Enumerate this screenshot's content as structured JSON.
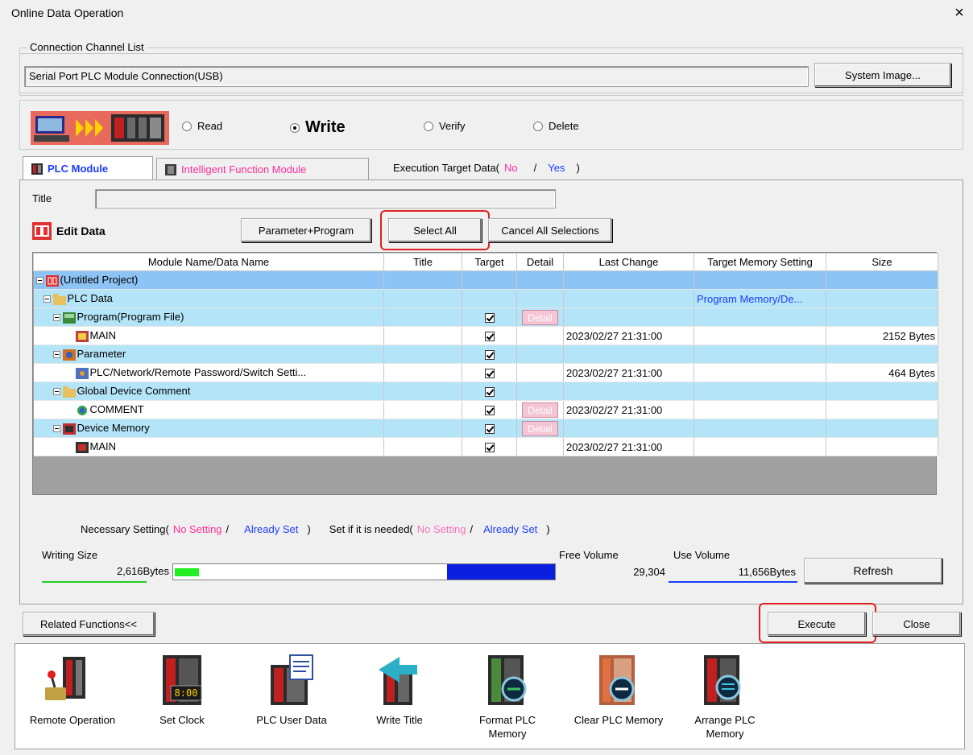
{
  "window": {
    "title": "Online Data Operation",
    "close_glyph": "×"
  },
  "connection": {
    "group_label": "Connection Channel List",
    "value": "Serial Port  PLC Module Connection(USB)",
    "system_image_button": "System Image..."
  },
  "operation": {
    "read": "Read",
    "write": "Write",
    "verify": "Verify",
    "delete": "Delete",
    "selected": "write"
  },
  "tabs": {
    "plc_module": "PLC Module",
    "intelligent": "Intelligent Function Module",
    "exec_target": "Execution Target Data(",
    "no": "No",
    "slash": "/",
    "yes": "Yes",
    "close_paren": ")"
  },
  "title_label": "Title",
  "title_value": "",
  "edit_data_label": "Edit Data",
  "buttons": {
    "param_program": "Parameter+Program",
    "select_all": "Select All",
    "cancel_all": "Cancel All Selections",
    "refresh": "Refresh",
    "related": "Related Functions<<",
    "execute": "Execute",
    "close": "Close"
  },
  "table": {
    "headers": [
      "Module Name/Data Name",
      "Title",
      "Target",
      "Detail",
      "Last Change",
      "Target Memory Setting",
      "Size"
    ],
    "detail_label": "Detail",
    "rows": [
      {
        "name": "(Untitled Project)",
        "title": "",
        "last": "",
        "mem": "",
        "size": ""
      },
      {
        "name": "PLC Data",
        "title": "",
        "last": "",
        "mem": "Program Memory/De...",
        "size": ""
      },
      {
        "name": "Program(Program File)",
        "title": "",
        "last": "",
        "mem": "",
        "size": ""
      },
      {
        "name": "MAIN",
        "title": "",
        "last": "2023/02/27 21:31:00",
        "mem": "",
        "size": "2152 Bytes"
      },
      {
        "name": "Parameter",
        "title": "",
        "last": "",
        "mem": "",
        "size": ""
      },
      {
        "name": "PLC/Network/Remote Password/Switch Setti...",
        "title": "",
        "last": "2023/02/27 21:31:00",
        "mem": "",
        "size": "464 Bytes"
      },
      {
        "name": "Global Device Comment",
        "title": "",
        "last": "",
        "mem": "",
        "size": ""
      },
      {
        "name": "COMMENT",
        "title": "",
        "last": "2023/02/27 21:31:00",
        "mem": "",
        "size": ""
      },
      {
        "name": "Device Memory",
        "title": "",
        "last": "",
        "mem": "",
        "size": ""
      },
      {
        "name": "MAIN",
        "title": "",
        "last": "2023/02/27 21:31:00",
        "mem": "",
        "size": ""
      }
    ]
  },
  "legend_line": {
    "necessary": "Necessary Setting(",
    "no_setting": "No Setting",
    "slash": "/",
    "already_set": "Already Set",
    "close_paren": ")",
    "if_needed": "Set if it is needed(",
    "no_setting2": "No Setting",
    "slash2": "/",
    "already_set2": "Already Set",
    "close_paren2": ")"
  },
  "sizes": {
    "writing_label": "Writing Size",
    "writing_value": "2,616Bytes",
    "free_label": "Free Volume",
    "free_value": "29,304",
    "use_label": "Use Volume",
    "use_value": "11,656Bytes"
  },
  "functions": [
    {
      "label": "Remote Operation",
      "icon": "remote-operation-icon"
    },
    {
      "label": "Set Clock",
      "icon": "set-clock-icon",
      "clock_text": "8:00"
    },
    {
      "label": "PLC User Data",
      "icon": "plc-user-data-icon"
    },
    {
      "label": "Write Title",
      "icon": "write-title-icon"
    },
    {
      "label": "Format PLC",
      "label2": "Memory",
      "icon": "format-plc-memory-icon"
    },
    {
      "label": "Clear PLC Memory",
      "icon": "clear-plc-memory-icon"
    },
    {
      "label": "Arrange PLC",
      "label2": "Memory",
      "icon": "arrange-plc-memory-icon"
    }
  ],
  "colors": {
    "pink": "#ff2e9a",
    "blue": "#1a3cff",
    "highlight": "#e02020"
  }
}
